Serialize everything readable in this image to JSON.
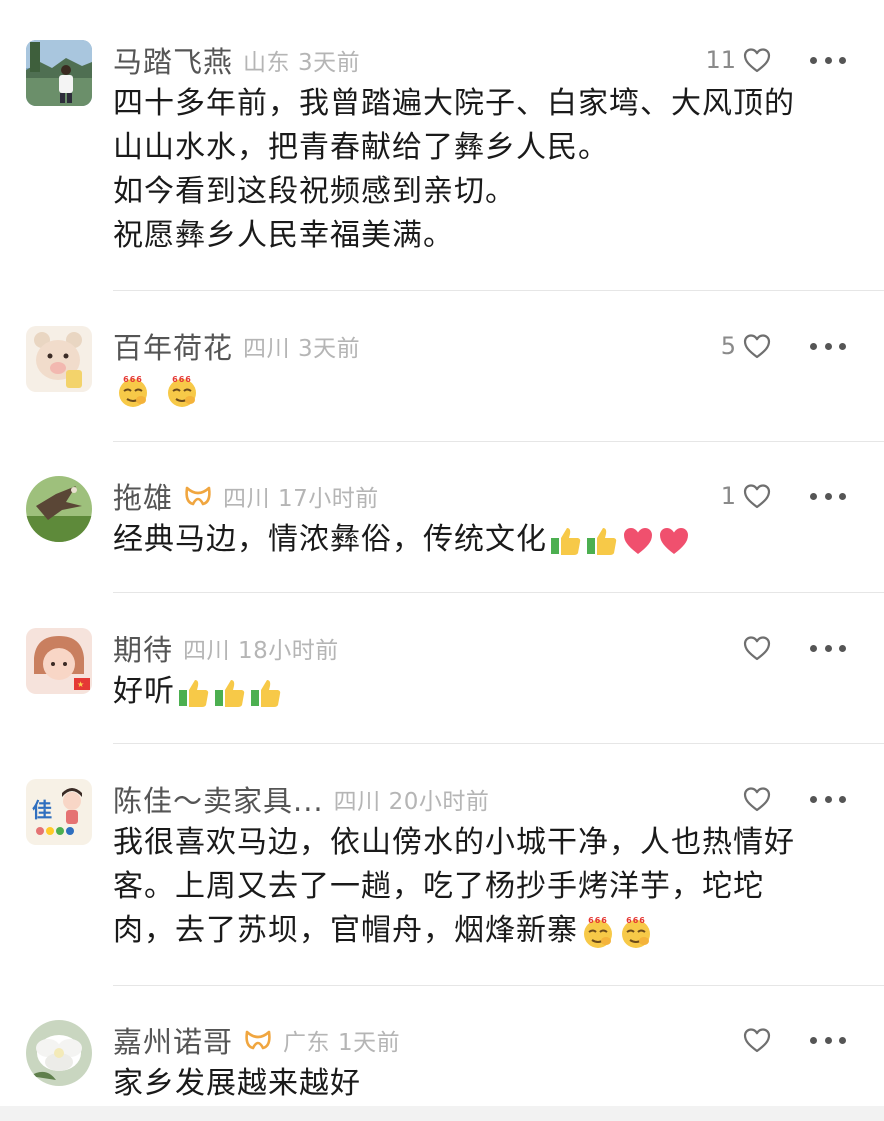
{
  "comments": [
    {
      "name": "马踏飞燕",
      "region": "山东",
      "time": "3天前",
      "likes": "11",
      "lines": [
        "四十多年前，我曾踏遍大院子、白家塆、大风顶的",
        "山山水水，把青春献给了彝乡人民。",
        "如今看到这段祝频感到亲切。",
        "祝愿彝乡人民幸福美满。"
      ]
    },
    {
      "name": "百年荷花",
      "region": "四川",
      "time": "3天前",
      "likes": "5",
      "lines": [
        ""
      ],
      "emoji": [
        "666-emoji",
        "666-emoji"
      ]
    },
    {
      "name": "拖雄",
      "badge": "gold-ribbon-badge-icon",
      "region": "四川",
      "time": "17小时前",
      "likes": "1",
      "lines": [
        "经典马边，情浓彝俗，传统文化"
      ],
      "emoji": [
        "thumbs-up-emoji",
        "thumbs-up-emoji",
        "red-heart-emoji",
        "red-heart-emoji"
      ]
    },
    {
      "name": "期待",
      "region": "四川",
      "time": "18小时前",
      "likes": "",
      "lines": [
        "好听"
      ],
      "emoji": [
        "thumbs-up-emoji",
        "thumbs-up-emoji",
        "thumbs-up-emoji"
      ]
    },
    {
      "name": "陈佳～卖家具...",
      "region": "四川",
      "time": "20小时前",
      "likes": "",
      "lines": [
        "我很喜欢马边，依山傍水的小城干净，人也热情好",
        "客。上周又去了一趟，吃了杨抄手烤洋芋，坨坨",
        "肉，去了苏坝，官帽舟，烟烽新寨"
      ],
      "emoji": [
        "666-emoji",
        "666-emoji"
      ]
    },
    {
      "name": "嘉州诺哥",
      "badge": "gold-ribbon-badge-icon",
      "region": "广东",
      "time": "1天前",
      "likes": "",
      "lines": [
        "家乡发展越来越好"
      ]
    }
  ],
  "avatar_text": {
    "c5": "佳"
  },
  "colors": {
    "name": "#555555",
    "meta": "#b5b5b5",
    "text": "#1a1a1a",
    "badge": "#f0a640",
    "divider": "#e6e6e6"
  }
}
